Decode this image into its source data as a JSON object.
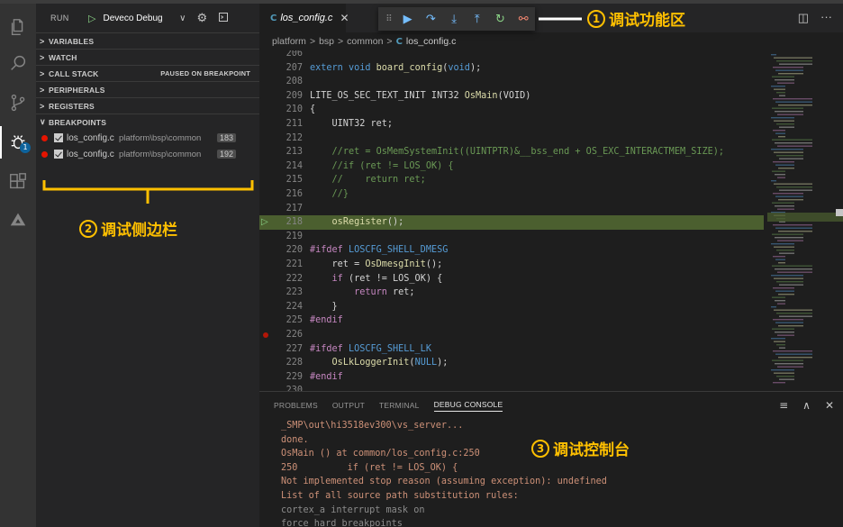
{
  "sidebar": {
    "run_title": "RUN",
    "config_name": "Deveco Debug",
    "sections": [
      {
        "label": "VARIABLES",
        "expanded": false,
        "extra": ""
      },
      {
        "label": "WATCH",
        "expanded": false,
        "extra": ""
      },
      {
        "label": "CALL STACK",
        "expanded": false,
        "extra": "PAUSED ON BREAKPOINT"
      },
      {
        "label": "PERIPHERALS",
        "expanded": false,
        "extra": ""
      },
      {
        "label": "REGISTERS",
        "expanded": false,
        "extra": ""
      },
      {
        "label": "BREAKPOINTS",
        "expanded": true,
        "extra": ""
      }
    ],
    "breakpoints": [
      {
        "file": "los_config.c",
        "path": "platform\\bsp\\common",
        "line": "183"
      },
      {
        "file": "los_config.c",
        "path": "platform\\bsp\\common",
        "line": "192"
      }
    ]
  },
  "annotations": {
    "toolbar": {
      "num": "1",
      "text": "调试功能区"
    },
    "sidebar": {
      "num": "2",
      "text": "调试侧边栏"
    },
    "console": {
      "num": "3",
      "text": "调试控制台"
    }
  },
  "editor": {
    "tab_label": "los_config.c",
    "breadcrumb": [
      "platform",
      "bsp",
      "common",
      "los_config.c"
    ],
    "lines": [
      {
        "n": "206",
        "html": ""
      },
      {
        "n": "207",
        "html": "<span class='kw'>extern</span> <span class='kw'>void</span> <span class='fn'>board_config</span>(<span class='kw'>void</span>);"
      },
      {
        "n": "208",
        "html": ""
      },
      {
        "n": "209",
        "html": "LITE_OS_SEC_TEXT_INIT INT32 <span class='fn'>OsMain</span>(VOID)"
      },
      {
        "n": "210",
        "html": "{"
      },
      {
        "n": "211",
        "html": "    UINT32 ret;"
      },
      {
        "n": "212",
        "html": ""
      },
      {
        "n": "213",
        "html": "    <span class='cm'>//ret = OsMemSystemInit((UINTPTR)&amp;__bss_end + OS_EXC_INTERACTMEM_SIZE);</span>"
      },
      {
        "n": "214",
        "html": "    <span class='cm'>//if (ret != LOS_OK) {</span>"
      },
      {
        "n": "215",
        "html": "    <span class='cm'>//    return ret;</span>"
      },
      {
        "n": "216",
        "html": "    <span class='cm'>//}</span>"
      },
      {
        "n": "217",
        "html": ""
      },
      {
        "n": "218",
        "html": "    <span class='fn'>osRegister</span>();",
        "hl": true,
        "current": true
      },
      {
        "n": "219",
        "html": ""
      },
      {
        "n": "220",
        "html": "<span class='ctl'>#ifdef</span> <span class='mac'>LOSCFG_SHELL_DMESG</span>"
      },
      {
        "n": "221",
        "html": "    ret = <span class='fn'>OsDmesgInit</span>();"
      },
      {
        "n": "222",
        "html": "    <span class='ctl'>if</span> (ret != LOS_OK) {"
      },
      {
        "n": "223",
        "html": "        <span class='ctl'>return</span> ret;"
      },
      {
        "n": "224",
        "html": "    }"
      },
      {
        "n": "225",
        "html": "<span class='ctl'>#endif</span>"
      },
      {
        "n": "226",
        "html": "",
        "bp": true
      },
      {
        "n": "227",
        "html": "<span class='ctl'>#ifdef</span> <span class='mac'>LOSCFG_SHELL_LK</span>"
      },
      {
        "n": "228",
        "html": "    <span class='fn'>OsLkLoggerInit</span>(<span class='kw'>NULL</span>);"
      },
      {
        "n": "229",
        "html": "<span class='ctl'>#endif</span>"
      },
      {
        "n": "230",
        "html": ""
      }
    ]
  },
  "panel": {
    "tabs": [
      "PROBLEMS",
      "OUTPUT",
      "TERMINAL",
      "DEBUG CONSOLE"
    ],
    "active_tab": "DEBUG CONSOLE",
    "console_lines": [
      {
        "text": "_SMP\\out\\hi3518ev300\\vs_server...",
        "plain": false
      },
      {
        "text": "done.",
        "plain": false
      },
      {
        "text": "OsMain () at common/los_config.c:250",
        "plain": false
      },
      {
        "text": "250         if (ret != LOS_OK) {",
        "plain": false
      },
      {
        "text": "Not implemented stop reason (assuming exception): undefined",
        "plain": false
      },
      {
        "text": "List of all source path substitution rules:",
        "plain": false
      },
      {
        "text": "cortex_a interrupt mask on",
        "plain": true
      },
      {
        "text": "force hard breakpoints",
        "plain": true
      }
    ]
  },
  "colors": {
    "accent_annotation": "#ffc000",
    "current_line_bg": "#4b5f2f",
    "breakpoint": "#e51400",
    "console_text": "#ce9178"
  }
}
